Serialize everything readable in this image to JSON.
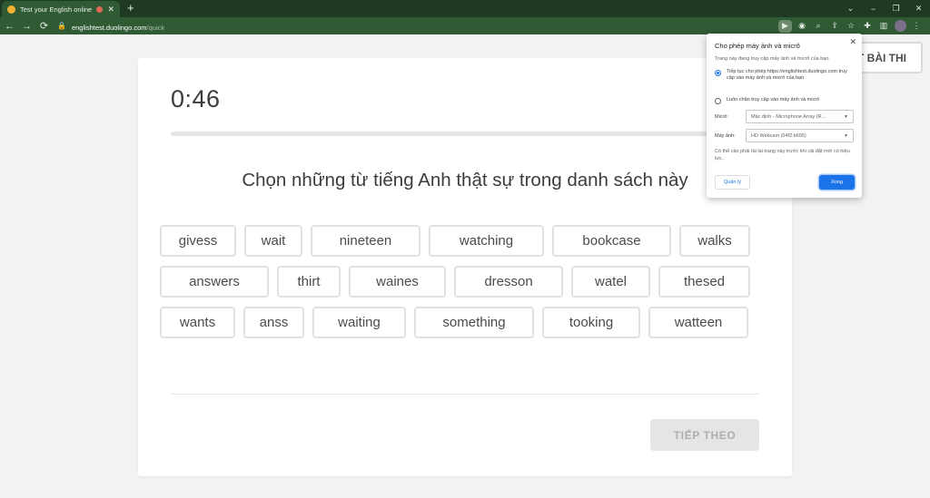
{
  "browser": {
    "tab": {
      "title": "Test your English online",
      "favicon": "duolingo-favicon-icon"
    },
    "new_tab_label": "+",
    "window_controls": {
      "minimize": "−",
      "restore": "❐",
      "close": "✕",
      "tabs_menu": "⌄"
    },
    "url": {
      "host": "englishtest.duolingo.com",
      "path": "/quick"
    }
  },
  "test": {
    "timer": "0:46",
    "progress": 0,
    "question": "Chọn những từ tiếng Anh thật sự trong danh sách này",
    "word_rows": [
      [
        "givess",
        "wait",
        "nineteen",
        "watching",
        "bookcase",
        "walks"
      ],
      [
        "answers",
        "thirt",
        "waines",
        "dresson",
        "watel",
        "thesed"
      ],
      [
        "wants",
        "anss",
        "waiting",
        "something",
        "tooking",
        "watteen"
      ]
    ],
    "next_button": "TIẾP THEO",
    "end_test_button": "T BÀI THI"
  },
  "permission_popup": {
    "title": "Cho phép máy ảnh và micrô",
    "description": "Trang này đang truy cập máy ảnh và micrô của bạn.",
    "option_allow": "Tiếp tục cho phép https://englishtest.duolingo.com truy cập vào máy ảnh và micrô của bạn",
    "option_block": "Luôn chặn truy cập vào máy ảnh và micrô",
    "mic_label": "Micrô:",
    "mic_value": "Mặc định - Microphone Array (R...",
    "camera_label": "Máy ảnh:",
    "camera_value": "HD Webcam (04f2:b695)",
    "note": "Có thể cần phải tải lại trang này trước khi cài đặt mới có hiệu lực.",
    "manage_button": "Quản lý",
    "done_button": "Xong"
  }
}
